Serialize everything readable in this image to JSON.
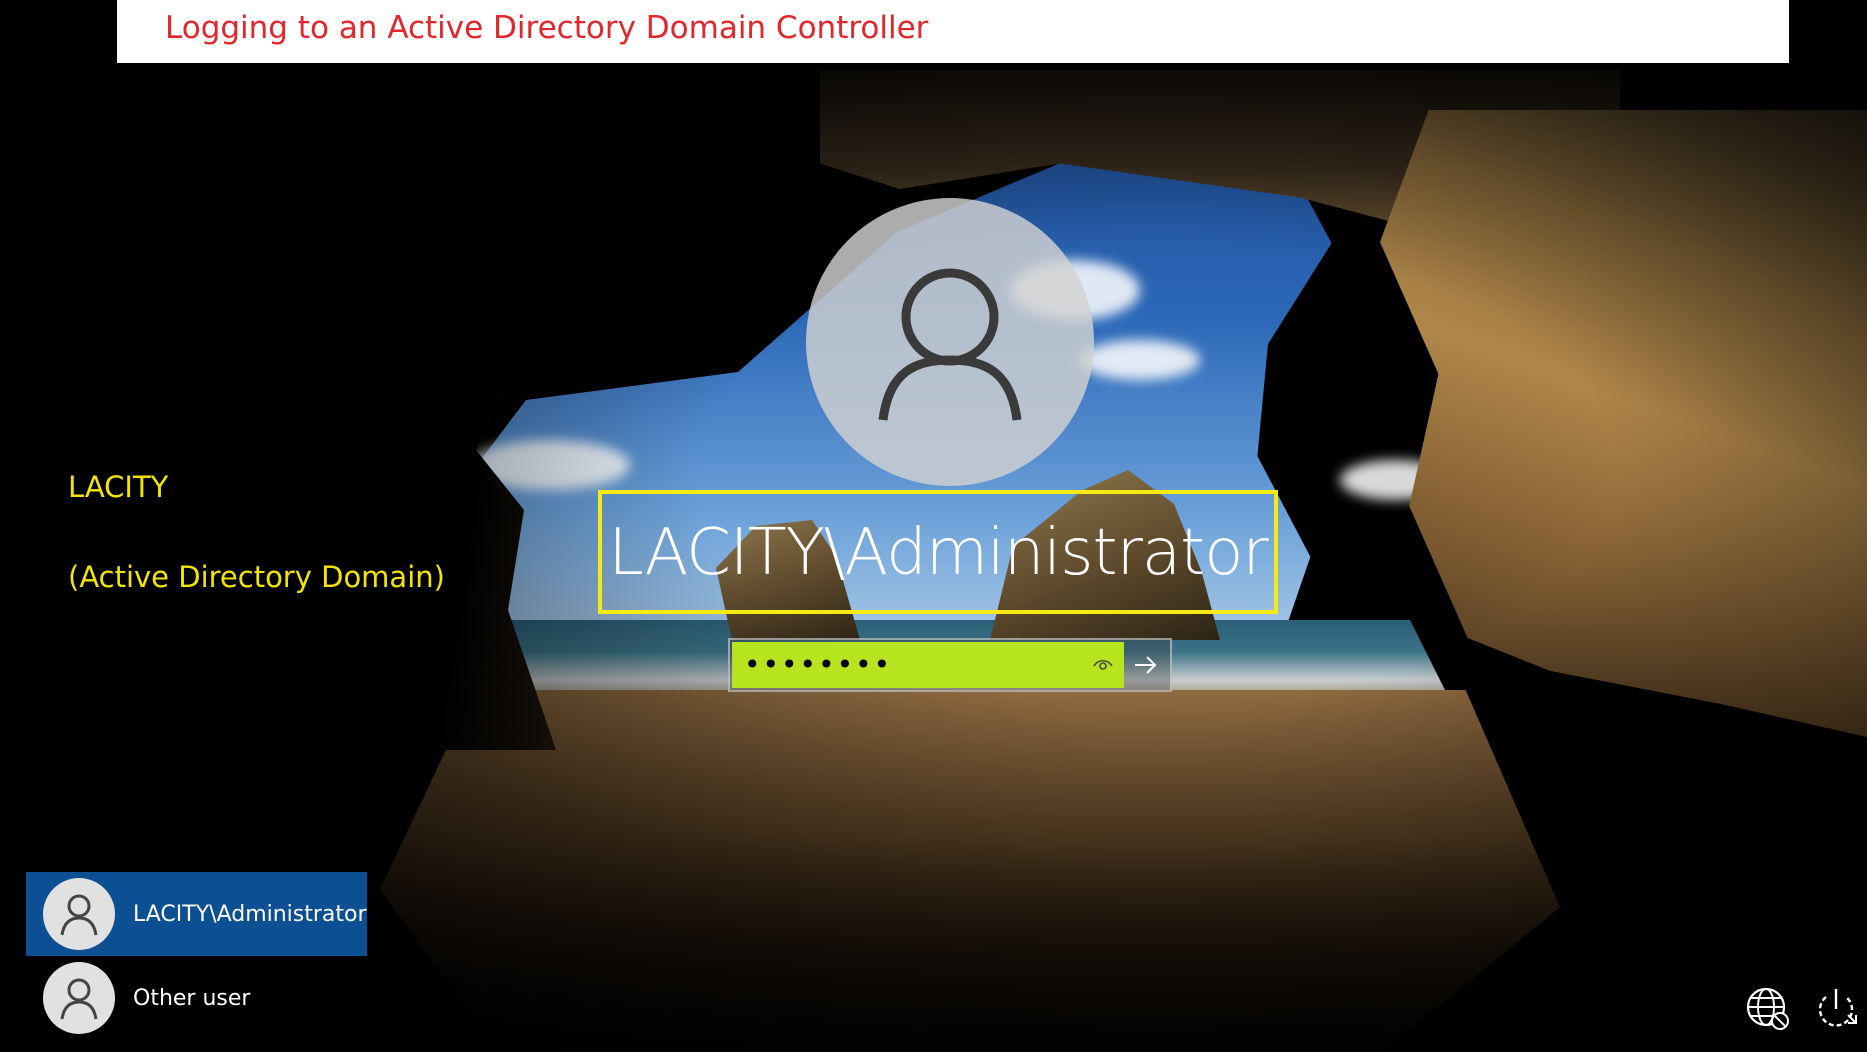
{
  "banner": {
    "title": "Logging to an Active Directory Domain Controller"
  },
  "annotations": {
    "domain_name": "LACITY",
    "domain_desc": "(Active Directory Domain)"
  },
  "login": {
    "username": "LACITY\\Administrator",
    "password_masked": "••••••••"
  },
  "user_list": [
    {
      "label": "LACITY\\Administrator",
      "selected": true
    },
    {
      "label": "Other user",
      "selected": false
    }
  ],
  "icons": {
    "avatar": "user-avatar-icon",
    "reveal": "eye-icon",
    "submit": "arrow-right-icon",
    "network": "network-globe-icon",
    "power": "power-icon"
  },
  "colors": {
    "banner_text": "#e3262b",
    "annotation": "#f2e600",
    "highlight_box": "#f5ea14",
    "password_highlight": "#b6e41e",
    "selected_user": "#0c4f92"
  }
}
